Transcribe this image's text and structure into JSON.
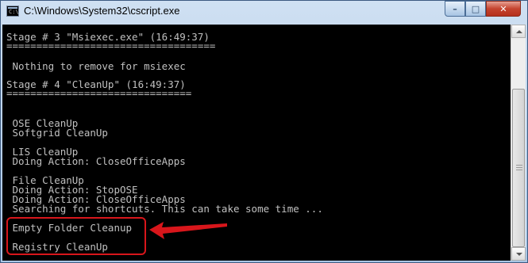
{
  "window": {
    "title": "C:\\Windows\\System32\\cscript.exe",
    "icon_text": "C:\\",
    "controls": {
      "minimize": "–",
      "maximize": "□",
      "close": "✕"
    }
  },
  "console": {
    "lines": [
      "Stage # 3 \"Msiexec.exe\" (16:49:37)",
      "===================================",
      "",
      " Nothing to remove for msiexec",
      "",
      "Stage # 4 \"CleanUp\" (16:49:37)",
      "===============================",
      "",
      "",
      " OSE CleanUp",
      " Softgrid CleanUp",
      "",
      " LIS CleanUp",
      " Doing Action: CloseOfficeApps",
      "",
      " File CleanUp",
      " Doing Action: StopOSE",
      " Doing Action: CloseOfficeApps",
      " Searching for shortcuts. This can take some time ...",
      "",
      " Empty Folder Cleanup",
      "",
      " Registry CleanUp"
    ]
  },
  "annotation": {
    "color": "#d8161b"
  }
}
